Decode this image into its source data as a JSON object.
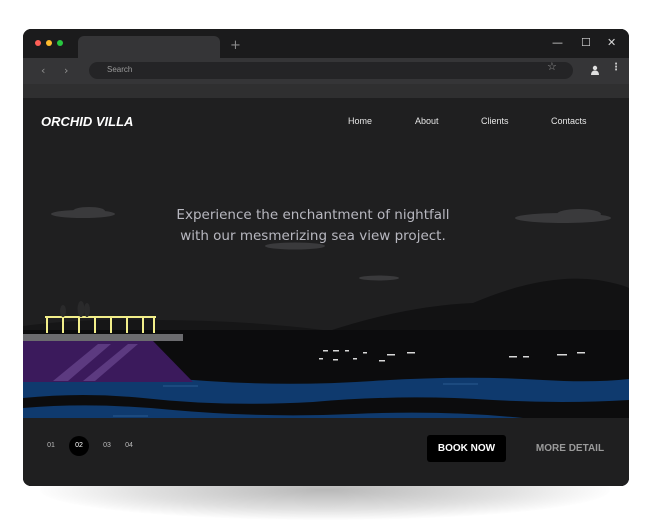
{
  "browser": {
    "address_placeholder": "Search",
    "new_tab_glyph": "+",
    "back_glyph": "‹",
    "forward_glyph": "›",
    "star_glyph": "☆",
    "menu_glyph": "⋮",
    "minimize_glyph": "—",
    "maximize_glyph": "☐",
    "close_glyph": "✕",
    "icons": [
      "back-icon",
      "forward-icon",
      "bookmark-star-icon",
      "profile-icon",
      "menu-kebab-icon",
      "minimize-icon",
      "maximize-icon",
      "close-icon"
    ]
  },
  "site": {
    "brand": "ORCHID VILLA",
    "nav": [
      "Home",
      "About",
      "Clients",
      "Contacts"
    ],
    "hero": {
      "line1": "Experience the enchantment of nightfall",
      "line2": "with our mesmerizing sea view project."
    },
    "slides": [
      "01",
      "02",
      "03",
      "04"
    ],
    "active_slide": "02",
    "cta_primary": "BOOK NOW",
    "cta_secondary": "MORE DETAIL"
  },
  "colors": {
    "traffic_red": "#ff5f57",
    "traffic_yellow": "#febc2e",
    "traffic_green": "#28c840",
    "water_blue": "#0f3a6e",
    "pool_purple": "#3b1a5c",
    "railing_yellow": "#f2ee8a",
    "page_bg": "#1f1f20"
  }
}
